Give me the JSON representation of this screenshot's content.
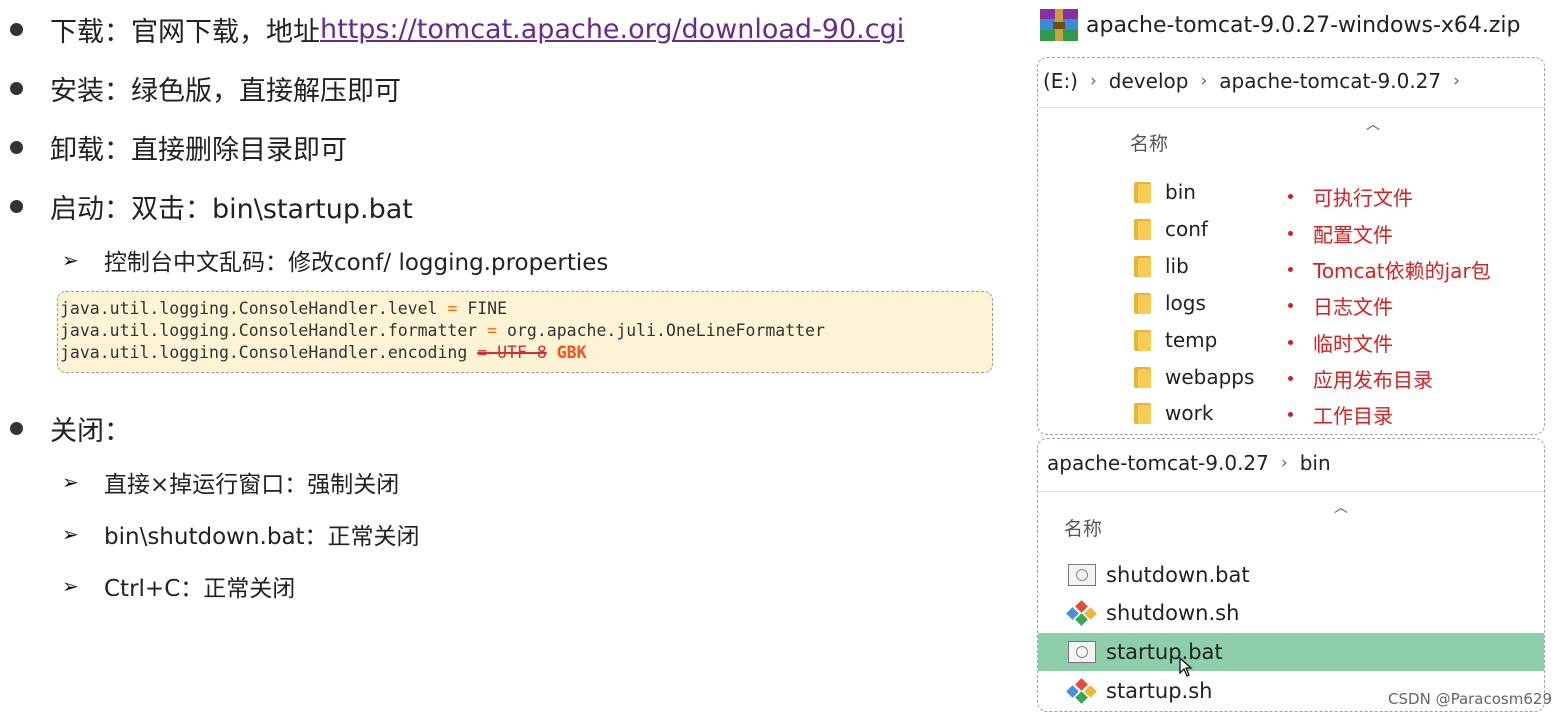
{
  "bullets": [
    {
      "label": "下载：官网下载，地址 ",
      "link": "https://tomcat.apache.org/download-90.cgi"
    },
    {
      "label": "安装：绿色版，直接解压即可"
    },
    {
      "label": "卸载：直接删除目录即可"
    },
    {
      "label": "启动：双击：bin\\startup.bat"
    },
    {
      "label": "关闭："
    }
  ],
  "startup_sub": "控制台中文乱码：修改conf/ logging.properties",
  "code": {
    "line1_key": "java.util.logging.ConsoleHandler.level",
    "line1_op": "=",
    "line1_val": "FINE",
    "line2_key": "java.util.logging.ConsoleHandler.formatter",
    "line2_op": "=",
    "line2_val": "org.apache.juli.OneLineFormatter",
    "line3_key": "java.util.logging.ConsoleHandler.encoding",
    "line3_op": "=",
    "line3_old": "UTF-8",
    "line3_new": "GBK"
  },
  "close_subs": [
    "直接×掉运行窗口：强制关闭",
    "bin\\shutdown.bat：正常关闭",
    "Ctrl+C：正常关闭"
  ],
  "zip": {
    "filename": "apache-tomcat-9.0.27-windows-x64.zip"
  },
  "explorer1": {
    "breadcrumb": [
      "(E:)",
      "develop",
      "apache-tomcat-9.0.27"
    ],
    "column_header": "名称",
    "folders": [
      {
        "name": "bin",
        "desc": "可执行文件"
      },
      {
        "name": "conf",
        "desc": "配置文件"
      },
      {
        "name": "lib",
        "desc": "Tomcat依赖的jar包"
      },
      {
        "name": "logs",
        "desc": "日志文件"
      },
      {
        "name": "temp",
        "desc": "临时文件"
      },
      {
        "name": "webapps",
        "desc": "应用发布目录"
      },
      {
        "name": "work",
        "desc": "工作目录"
      }
    ]
  },
  "explorer2": {
    "breadcrumb": [
      "apache-tomcat-9.0.27",
      "bin"
    ],
    "column_header": "名称",
    "files": [
      {
        "name": "shutdown.bat",
        "icon": "bat-file-icon",
        "selected": false
      },
      {
        "name": "shutdown.sh",
        "icon": "sh-file-icon",
        "selected": false
      },
      {
        "name": "startup.bat",
        "icon": "bat-file-icon",
        "selected": true
      },
      {
        "name": "startup.sh",
        "icon": "sh-file-icon",
        "selected": false
      }
    ]
  },
  "watermark": "CSDN @Paracosm629",
  "colors": {
    "annotation_red": "#d81e1e",
    "selected_row": "#8dcfaa",
    "link": "#6a2a8c"
  }
}
